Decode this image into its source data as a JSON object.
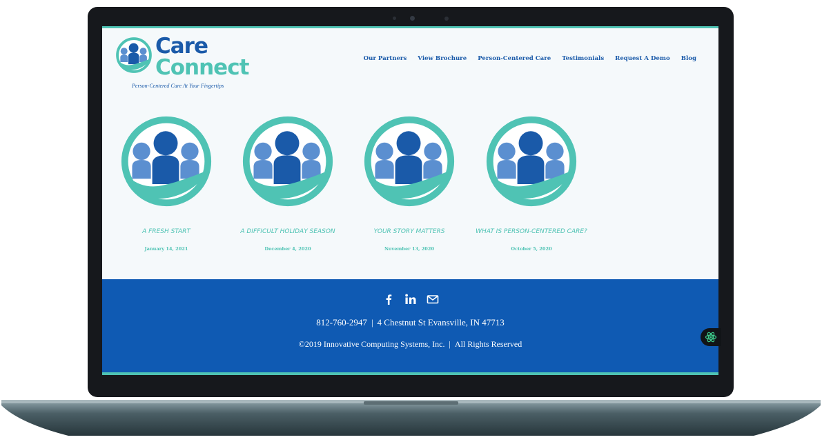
{
  "brand": {
    "name_line1": "Care",
    "name_line2": "Connect",
    "tagline": "Person-Centered Care At Your Fingertips"
  },
  "nav": {
    "items": [
      {
        "label": "Our Partners"
      },
      {
        "label": "View Brochure"
      },
      {
        "label": "Person-Centered Care"
      },
      {
        "label": "Testimonials"
      },
      {
        "label": "Request A Demo"
      },
      {
        "label": "Blog"
      }
    ]
  },
  "posts": [
    {
      "title": "A Fresh Start",
      "date": "January 14, 2021",
      "icon": "care-connect-people-icon"
    },
    {
      "title": "A Difficult Holiday Season",
      "date": "December 4, 2020",
      "icon": "care-connect-people-icon"
    },
    {
      "title": "Your Story Matters",
      "date": "November 13, 2020",
      "icon": "care-connect-people-icon"
    },
    {
      "title": "What Is Person-Centered Care?",
      "date": "October 5, 2020",
      "icon": "care-connect-people-icon"
    }
  ],
  "footer": {
    "social": [
      "facebook-icon",
      "linkedin-icon",
      "email-icon"
    ],
    "phone": "812-760-2947",
    "separator": "|",
    "address": "4 Chestnut St Evansville, IN 47713",
    "copyright": "©2019 Innovative Computing Systems, Inc.",
    "rights": "All Rights Reserved"
  },
  "colors": {
    "brand_blue": "#1a5aa9",
    "brand_teal": "#4fc3b4",
    "footer_blue": "#0f5ab3",
    "light_blue": "#5b8fd0"
  }
}
